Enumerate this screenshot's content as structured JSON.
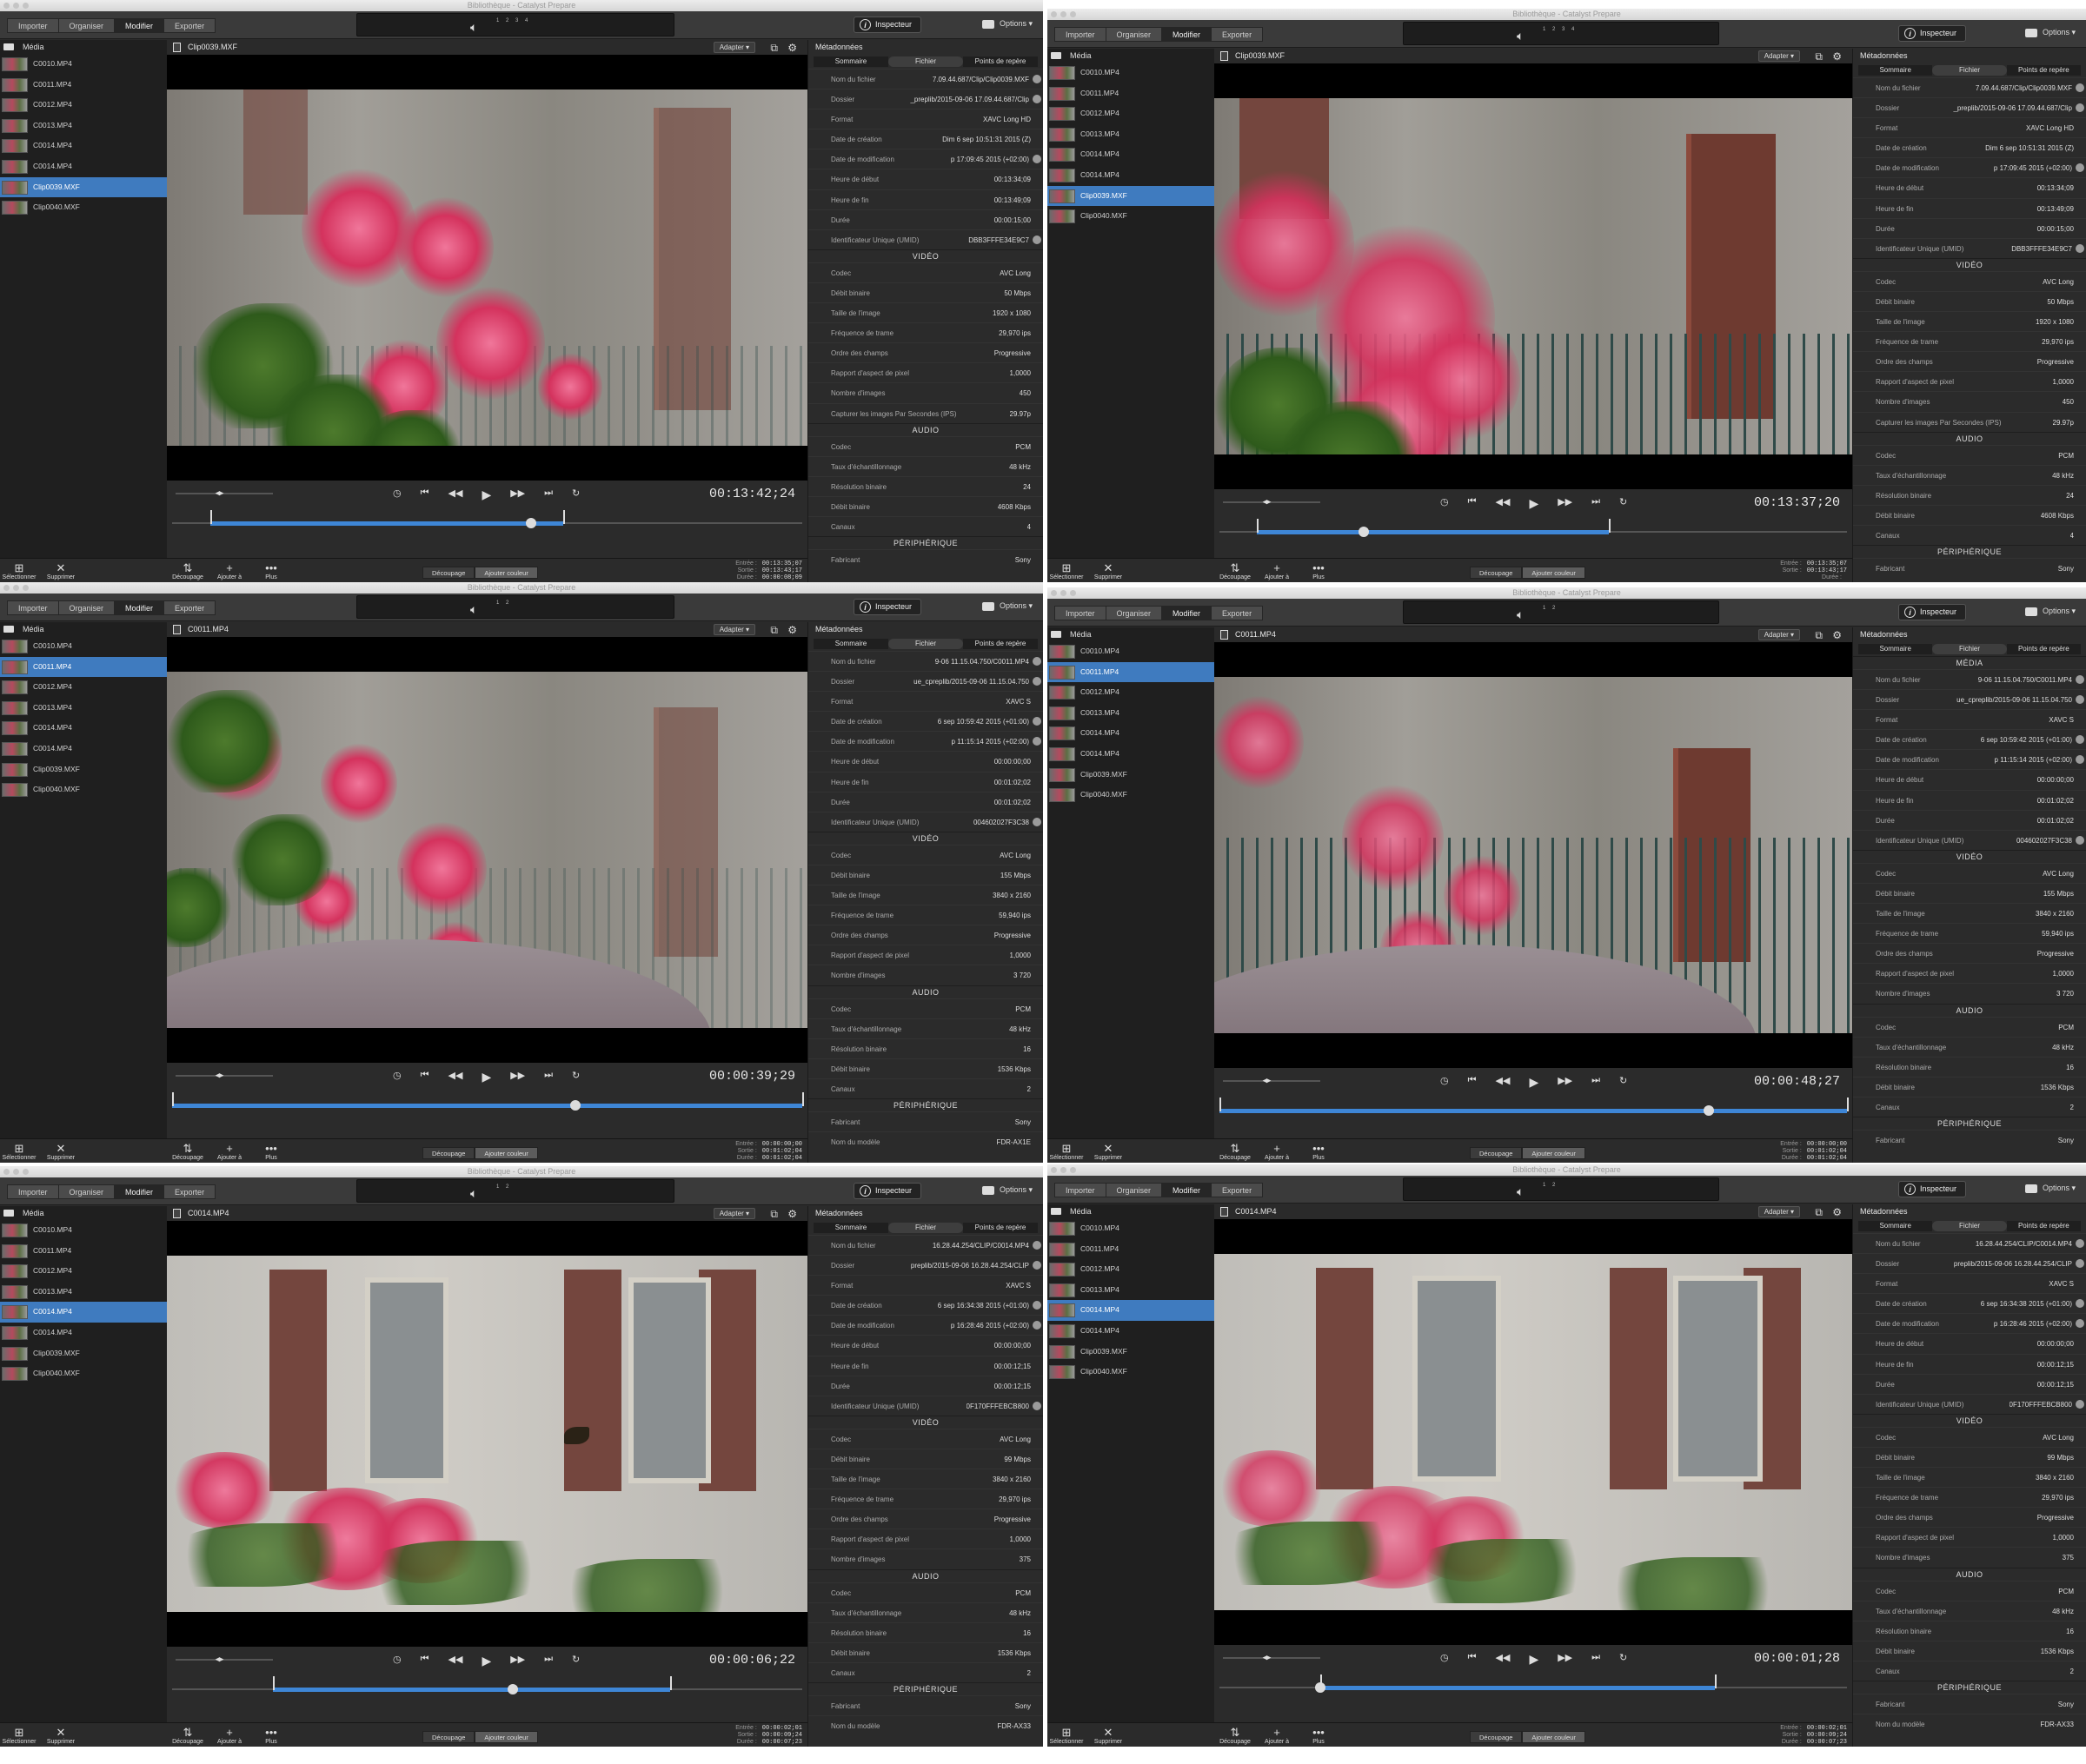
{
  "app": {
    "window_title": "Bibliothèque - Catalyst Prepare",
    "modes": [
      "Importer",
      "Organiser",
      "Modifier",
      "Exporter"
    ],
    "active_mode": "Modifier",
    "inspector_label": "Inspecteur",
    "options_label": "Options",
    "media_label": "Média",
    "adapt_label": "Adapter",
    "metadata_title": "Métadonnées",
    "meta_tabs": [
      "Sommaire",
      "Fichier",
      "Points de repère"
    ],
    "active_meta_tab": "Fichier",
    "sidebar_buttons": [
      "Sélectionner",
      "Supprimer"
    ],
    "bottom_buttons": [
      "Découpage",
      "Ajouter à",
      "Plus"
    ],
    "segment": [
      "Découpage",
      "Ajouter couleur"
    ],
    "io_labels": [
      "Entrée :",
      "Sortie :",
      "Durée :"
    ],
    "clips": [
      "C0010.MP4",
      "C0011.MP4",
      "C0012.MP4",
      "C0013.MP4",
      "C0014.MP4",
      "C0014.MP4",
      "Clip0039.MXF",
      "Clip0040.MXF"
    ],
    "section_labels": {
      "media": "MÉDIA",
      "video": "VIDÉO",
      "audio": "AUDIO",
      "peripheral": "PÉRIPHÉRIQUE"
    },
    "colors": {
      "selection": "#3f7bbf",
      "accent": "#3e86d6",
      "panel": "#2b2b2b"
    }
  },
  "panels": [
    {
      "selected_index": 6,
      "filename": "Clip0039.MXF",
      "meters": "1 2 3 4",
      "timecode": "00:13:42;24",
      "scene": "flowers-left",
      "scrub": {
        "in": 0.06,
        "out": 0.62,
        "head": 0.57
      },
      "io": [
        "00:13:35;07",
        "00:13:43;17",
        "00:00:08;09"
      ],
      "file": [
        {
          "k": "Nom du fichier",
          "v": "7.09.44.687/Clip/Clip0039.MXF",
          "info": true
        },
        {
          "k": "Dossier",
          "v": "_preplib/2015-09-06 17.09.44.687/Clip",
          "info": true
        },
        {
          "k": "Format",
          "v": "XAVC Long HD",
          "info": false
        },
        {
          "k": "Date de création",
          "v": "Dim 6 sep 10:51:31 2015 (Z)",
          "info": false
        },
        {
          "k": "Date de modification",
          "v": "p 17:09:45 2015 (+02:00)",
          "info": true
        },
        {
          "k": "Heure de début",
          "v": "00:13:34;09",
          "info": false
        },
        {
          "k": "Heure de fin",
          "v": "00:13:49;09",
          "info": false
        },
        {
          "k": "Durée",
          "v": "00:00:15;00",
          "info": false
        },
        {
          "k": "Identificateur Unique (UMID)",
          "v": "DBB3FFFE34E9C7",
          "info": true
        }
      ],
      "video": [
        {
          "k": "Codec",
          "v": "AVC Long"
        },
        {
          "k": "Débit binaire",
          "v": "50 Mbps"
        },
        {
          "k": "Taille de l'image",
          "v": "1920 x 1080"
        },
        {
          "k": "Fréquence de trame",
          "v": "29,970 ips"
        },
        {
          "k": "Ordre des champs",
          "v": "Progressive"
        },
        {
          "k": "Rapport d'aspect de pixel",
          "v": "1,0000"
        },
        {
          "k": "Nombre d'images",
          "v": "450"
        },
        {
          "k": "Capturer les images Par Secondes (IPS)",
          "v": "29.97p"
        }
      ],
      "audio": [
        {
          "k": "Codec",
          "v": "PCM"
        },
        {
          "k": "Taux d'échantillonnage",
          "v": "48 kHz"
        },
        {
          "k": "Résolution binaire",
          "v": "24"
        },
        {
          "k": "Débit binaire",
          "v": "4608 Kbps"
        },
        {
          "k": "Canaux",
          "v": "4"
        }
      ],
      "peripheral": [
        {
          "k": "Fabricant",
          "v": "Sony"
        }
      ]
    },
    {
      "selected_index": 6,
      "filename": "Clip0039.MXF",
      "meters": "1 2 3 4",
      "timecode": "00:13:37;20",
      "scene": "flowers-door",
      "scrub": {
        "in": 0.06,
        "out": 0.62,
        "head": 0.23
      },
      "io": [
        "00:13:35;07",
        "00:13:43;17",
        ""
      ],
      "file": [
        {
          "k": "Nom du fichier",
          "v": "7.09.44.687/Clip/Clip0039.MXF",
          "info": true
        },
        {
          "k": "Dossier",
          "v": "_preplib/2015-09-06 17.09.44.687/Clip",
          "info": true
        },
        {
          "k": "Format",
          "v": "XAVC Long HD",
          "info": false
        },
        {
          "k": "Date de création",
          "v": "Dim 6 sep 10:51:31 2015 (Z)",
          "info": false
        },
        {
          "k": "Date de modification",
          "v": "p 17:09:45 2015 (+02:00)",
          "info": true
        },
        {
          "k": "Heure de début",
          "v": "00:13:34;09",
          "info": false
        },
        {
          "k": "Heure de fin",
          "v": "00:13:49;09",
          "info": false
        },
        {
          "k": "Durée",
          "v": "00:00:15;00",
          "info": false
        },
        {
          "k": "Identificateur Unique (UMID)",
          "v": "DBB3FFFE34E9C7",
          "info": true
        }
      ],
      "video": [
        {
          "k": "Codec",
          "v": "AVC Long"
        },
        {
          "k": "Débit binaire",
          "v": "50 Mbps"
        },
        {
          "k": "Taille de l'image",
          "v": "1920 x 1080"
        },
        {
          "k": "Fréquence de trame",
          "v": "29,970 ips"
        },
        {
          "k": "Ordre des champs",
          "v": "Progressive"
        },
        {
          "k": "Rapport d'aspect de pixel",
          "v": "1,0000"
        },
        {
          "k": "Nombre d'images",
          "v": "450"
        },
        {
          "k": "Capturer les images Par Secondes (IPS)",
          "v": "29.97p"
        }
      ],
      "audio": [
        {
          "k": "Codec",
          "v": "PCM"
        },
        {
          "k": "Taux d'échantillonnage",
          "v": "48 kHz"
        },
        {
          "k": "Résolution binaire",
          "v": "24"
        },
        {
          "k": "Débit binaire",
          "v": "4608 Kbps"
        },
        {
          "k": "Canaux",
          "v": "4"
        }
      ],
      "peripheral": [
        {
          "k": "Fabricant",
          "v": "Sony"
        }
      ]
    },
    {
      "selected_index": 1,
      "filename": "C0011.MP4",
      "meters": "1 2",
      "timecode": "00:00:39;29",
      "scene": "pot-fence",
      "scrub": {
        "in": 0.0,
        "out": 1.0,
        "head": 0.64
      },
      "io": [
        "00:00:00;00",
        "00:01:02;04",
        "00:01:02;04"
      ],
      "file": [
        {
          "k": "Nom du fichier",
          "v": "9-06 11.15.04.750/C0011.MP4",
          "info": true
        },
        {
          "k": "Dossier",
          "v": "ue_cpreplib/2015-09-06 11.15.04.750",
          "info": true
        },
        {
          "k": "Format",
          "v": "XAVC S",
          "info": false
        },
        {
          "k": "Date de création",
          "v": "6 sep 10:59:42 2015 (+01:00)",
          "info": true
        },
        {
          "k": "Date de modification",
          "v": "p 11:15:14 2015 (+02:00)",
          "info": true
        },
        {
          "k": "Heure de début",
          "v": "00:00:00;00",
          "info": false
        },
        {
          "k": "Heure de fin",
          "v": "00:01:02;02",
          "info": false
        },
        {
          "k": "Durée",
          "v": "00:01:02;02",
          "info": false
        },
        {
          "k": "Identificateur Unique (UMID)",
          "v": "004602027F3C38",
          "info": true
        }
      ],
      "video": [
        {
          "k": "Codec",
          "v": "AVC Long"
        },
        {
          "k": "Débit binaire",
          "v": "155 Mbps"
        },
        {
          "k": "Taille de l'image",
          "v": "3840 x 2160"
        },
        {
          "k": "Fréquence de trame",
          "v": "59,940 ips"
        },
        {
          "k": "Ordre des champs",
          "v": "Progressive"
        },
        {
          "k": "Rapport d'aspect de pixel",
          "v": "1,0000"
        },
        {
          "k": "Nombre d'images",
          "v": "3 720"
        }
      ],
      "audio": [
        {
          "k": "Codec",
          "v": "PCM"
        },
        {
          "k": "Taux d'échantillonnage",
          "v": "48 kHz"
        },
        {
          "k": "Résolution binaire",
          "v": "16"
        },
        {
          "k": "Débit binaire",
          "v": "1536 Kbps"
        },
        {
          "k": "Canaux",
          "v": "2"
        }
      ],
      "peripheral": [
        {
          "k": "Fabricant",
          "v": "Sony"
        },
        {
          "k": "Nom du modèle",
          "v": "FDR-AX1E"
        }
      ]
    },
    {
      "selected_index": 1,
      "filename": "C0011.MP4",
      "meters": "1 2",
      "timecode": "00:00:48;27",
      "scene": "pot-door",
      "scrub": {
        "in": 0.0,
        "out": 1.0,
        "head": 0.78
      },
      "io": [
        "00:00:00;00",
        "00:01:02;04",
        "00:01:02;04"
      ],
      "has_media_section": true,
      "file": [
        {
          "k": "Nom du fichier",
          "v": "9-06 11.15.04.750/C0011.MP4",
          "info": true
        },
        {
          "k": "Dossier",
          "v": "ue_cpreplib/2015-09-06 11.15.04.750",
          "info": true
        },
        {
          "k": "Format",
          "v": "XAVC S",
          "info": false
        },
        {
          "k": "Date de création",
          "v": "6 sep 10:59:42 2015 (+01:00)",
          "info": true
        },
        {
          "k": "Date de modification",
          "v": "p 11:15:14 2015 (+02:00)",
          "info": true
        },
        {
          "k": "Heure de début",
          "v": "00:00:00;00",
          "info": false
        },
        {
          "k": "Heure de fin",
          "v": "00:01:02;02",
          "info": false
        },
        {
          "k": "Durée",
          "v": "00:01:02;02",
          "info": false
        },
        {
          "k": "Identificateur Unique (UMID)",
          "v": "004602027F3C38",
          "info": true
        }
      ],
      "video": [
        {
          "k": "Codec",
          "v": "AVC Long"
        },
        {
          "k": "Débit binaire",
          "v": "155 Mbps"
        },
        {
          "k": "Taille de l'image",
          "v": "3840 x 2160"
        },
        {
          "k": "Fréquence de trame",
          "v": "59,940 ips"
        },
        {
          "k": "Ordre des champs",
          "v": "Progressive"
        },
        {
          "k": "Rapport d'aspect de pixel",
          "v": "1,0000"
        },
        {
          "k": "Nombre d'images",
          "v": "3 720"
        }
      ],
      "audio": [
        {
          "k": "Codec",
          "v": "PCM"
        },
        {
          "k": "Taux d'échantillonnage",
          "v": "48 kHz"
        },
        {
          "k": "Résolution binaire",
          "v": "16"
        },
        {
          "k": "Débit binaire",
          "v": "1536 Kbps"
        },
        {
          "k": "Canaux",
          "v": "2"
        }
      ],
      "peripheral": [
        {
          "k": "Fabricant",
          "v": "Sony"
        }
      ]
    },
    {
      "selected_index": 4,
      "filename": "C0014.MP4",
      "meters": "1 2",
      "timecode": "00:00:06;22",
      "scene": "shutters-bee",
      "scrub": {
        "in": 0.16,
        "out": 0.79,
        "head": 0.54
      },
      "io": [
        "00:00:02;01",
        "00:00:09;24",
        "00:00:07;23"
      ],
      "file": [
        {
          "k": "Nom du fichier",
          "v": "16.28.44.254/CLIP/C0014.MP4",
          "info": true
        },
        {
          "k": "Dossier",
          "v": "preplib/2015-09-06 16.28.44.254/CLIP",
          "info": true
        },
        {
          "k": "Format",
          "v": "XAVC S",
          "info": false
        },
        {
          "k": "Date de création",
          "v": "6 sep 16:34:38 2015 (+01:00)",
          "info": true
        },
        {
          "k": "Date de modification",
          "v": "p 16:28:46 2015 (+02:00)",
          "info": true
        },
        {
          "k": "Heure de début",
          "v": "00:00:00;00",
          "info": false
        },
        {
          "k": "Heure de fin",
          "v": "00:00:12;15",
          "info": false
        },
        {
          "k": "Durée",
          "v": "00:00:12;15",
          "info": false
        },
        {
          "k": "Identificateur Unique (UMID)",
          "v": "0F170FFFEBCB800",
          "info": true
        }
      ],
      "video": [
        {
          "k": "Codec",
          "v": "AVC Long"
        },
        {
          "k": "Débit binaire",
          "v": "99 Mbps"
        },
        {
          "k": "Taille de l'image",
          "v": "3840 x 2160"
        },
        {
          "k": "Fréquence de trame",
          "v": "29,970 ips"
        },
        {
          "k": "Ordre des champs",
          "v": "Progressive"
        },
        {
          "k": "Rapport d'aspect de pixel",
          "v": "1,0000"
        },
        {
          "k": "Nombre d'images",
          "v": "375"
        }
      ],
      "audio": [
        {
          "k": "Codec",
          "v": "PCM"
        },
        {
          "k": "Taux d'échantillonnage",
          "v": "48 kHz"
        },
        {
          "k": "Résolution binaire",
          "v": "16"
        },
        {
          "k": "Débit binaire",
          "v": "1536 Kbps"
        },
        {
          "k": "Canaux",
          "v": "2"
        }
      ],
      "peripheral": [
        {
          "k": "Fabricant",
          "v": "Sony"
        },
        {
          "k": "Nom du modèle",
          "v": "FDR-AX33"
        }
      ]
    },
    {
      "selected_index": 4,
      "filename": "C0014.MP4",
      "meters": "1 2",
      "timecode": "00:00:01;28",
      "scene": "shutters-sharp",
      "scrub": {
        "in": 0.16,
        "out": 0.79,
        "head": 0.16
      },
      "io": [
        "00:00:02;01",
        "00:00:09;24",
        "00:00:07;23"
      ],
      "file": [
        {
          "k": "Nom du fichier",
          "v": "16.28.44.254/CLIP/C0014.MP4",
          "info": true
        },
        {
          "k": "Dossier",
          "v": "preplib/2015-09-06 16.28.44.254/CLIP",
          "info": true
        },
        {
          "k": "Format",
          "v": "XAVC S",
          "info": false
        },
        {
          "k": "Date de création",
          "v": "6 sep 16:34:38 2015 (+01:00)",
          "info": true
        },
        {
          "k": "Date de modification",
          "v": "p 16:28:46 2015 (+02:00)",
          "info": true
        },
        {
          "k": "Heure de début",
          "v": "00:00:00;00",
          "info": false
        },
        {
          "k": "Heure de fin",
          "v": "00:00:12;15",
          "info": false
        },
        {
          "k": "Durée",
          "v": "00:00:12;15",
          "info": false
        },
        {
          "k": "Identificateur Unique (UMID)",
          "v": "0F170FFFEBCB800",
          "info": true
        }
      ],
      "video": [
        {
          "k": "Codec",
          "v": "AVC Long"
        },
        {
          "k": "Débit binaire",
          "v": "99 Mbps"
        },
        {
          "k": "Taille de l'image",
          "v": "3840 x 2160"
        },
        {
          "k": "Fréquence de trame",
          "v": "29,970 ips"
        },
        {
          "k": "Ordre des champs",
          "v": "Progressive"
        },
        {
          "k": "Rapport d'aspect de pixel",
          "v": "1,0000"
        },
        {
          "k": "Nombre d'images",
          "v": "375"
        }
      ],
      "audio": [
        {
          "k": "Codec",
          "v": "PCM"
        },
        {
          "k": "Taux d'échantillonnage",
          "v": "48 kHz"
        },
        {
          "k": "Résolution binaire",
          "v": "16"
        },
        {
          "k": "Débit binaire",
          "v": "1536 Kbps"
        },
        {
          "k": "Canaux",
          "v": "2"
        }
      ],
      "peripheral": [
        {
          "k": "Fabricant",
          "v": "Sony"
        },
        {
          "k": "Nom du modèle",
          "v": "FDR-AX33"
        }
      ]
    }
  ]
}
